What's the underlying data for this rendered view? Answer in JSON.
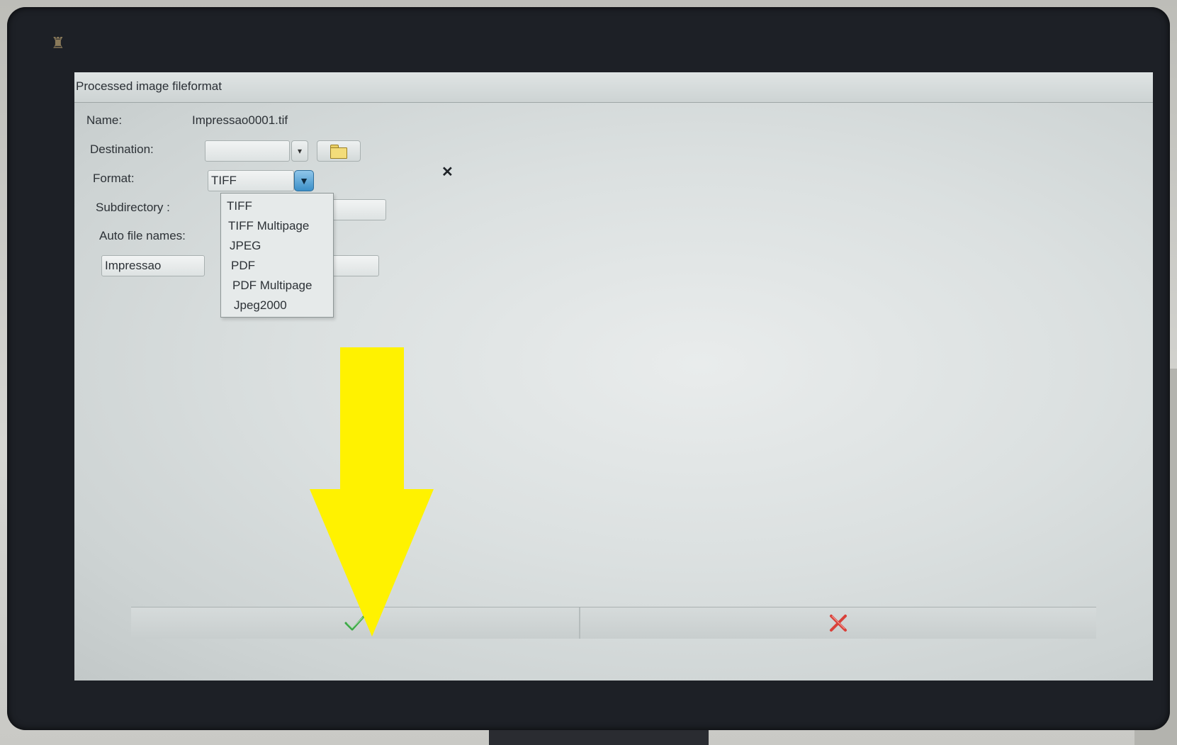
{
  "window": {
    "title": "Processed image fileformat"
  },
  "form": {
    "name_label": "Name:",
    "name_value": "Impressao0001.tif",
    "destination_label": "Destination:",
    "destination_value": "",
    "format_label": "Format:",
    "format_value": "TIFF",
    "subdirectory_label": "Subdirectory :",
    "auto_file_names_label": "Auto file names:",
    "prefix_value": "Impressao"
  },
  "format_dropdown": {
    "options": [
      {
        "label": "TIFF"
      },
      {
        "label": "TIFF Multipage"
      },
      {
        "label": "JPEG"
      },
      {
        "label": "PDF"
      },
      {
        "label": "PDF Multipage"
      },
      {
        "label": "Jpeg2000"
      }
    ]
  },
  "colors": {
    "annotation_arrow": "#fff200",
    "ok_check": "#3aa845",
    "cancel_x": "#d9413a",
    "dropdown_button": "#3b8fc8"
  },
  "icons": {
    "ok": "check-icon",
    "cancel": "red-x-icon",
    "browse": "folder-icon",
    "close": "close-icon"
  }
}
